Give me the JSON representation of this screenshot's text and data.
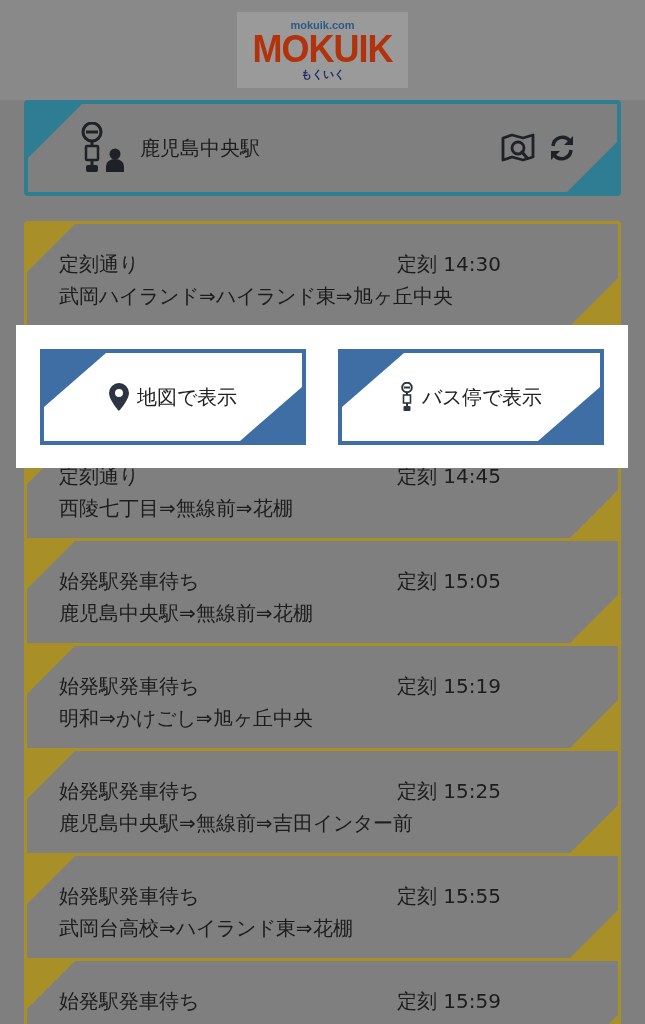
{
  "header": {
    "logo": {
      "domain": "mokuik.com",
      "name": "MOKUIK",
      "kana": "もくいく"
    }
  },
  "stop": {
    "name": "鹿児島中央駅"
  },
  "departures": [
    {
      "status": "定刻通り",
      "time": "定刻 14:30",
      "route": "武岡ハイランド⇒ハイランド東⇒旭ヶ丘中央"
    },
    {
      "status": "定刻通り",
      "time": "定刻 14:45",
      "route": "西陵七丁目⇒無線前⇒花棚"
    },
    {
      "status": "始発駅発車待ち",
      "time": "定刻 15:05",
      "route": "鹿児島中央駅⇒無線前⇒花棚"
    },
    {
      "status": "始発駅発車待ち",
      "time": "定刻 15:19",
      "route": "明和⇒かけごし⇒旭ヶ丘中央"
    },
    {
      "status": "始発駅発車待ち",
      "time": "定刻 15:25",
      "route": "鹿児島中央駅⇒無線前⇒吉田インター前"
    },
    {
      "status": "始発駅発車待ち",
      "time": "定刻 15:55",
      "route": "武岡台高校⇒ハイランド東⇒花棚"
    },
    {
      "status": "始発駅発車待ち",
      "time": "定刻 15:59"
    }
  ],
  "dialog": {
    "buttons": [
      {
        "label": "地図で表示",
        "kind": "map"
      },
      {
        "label": "バス停で表示",
        "kind": "bus_stop"
      }
    ]
  }
}
